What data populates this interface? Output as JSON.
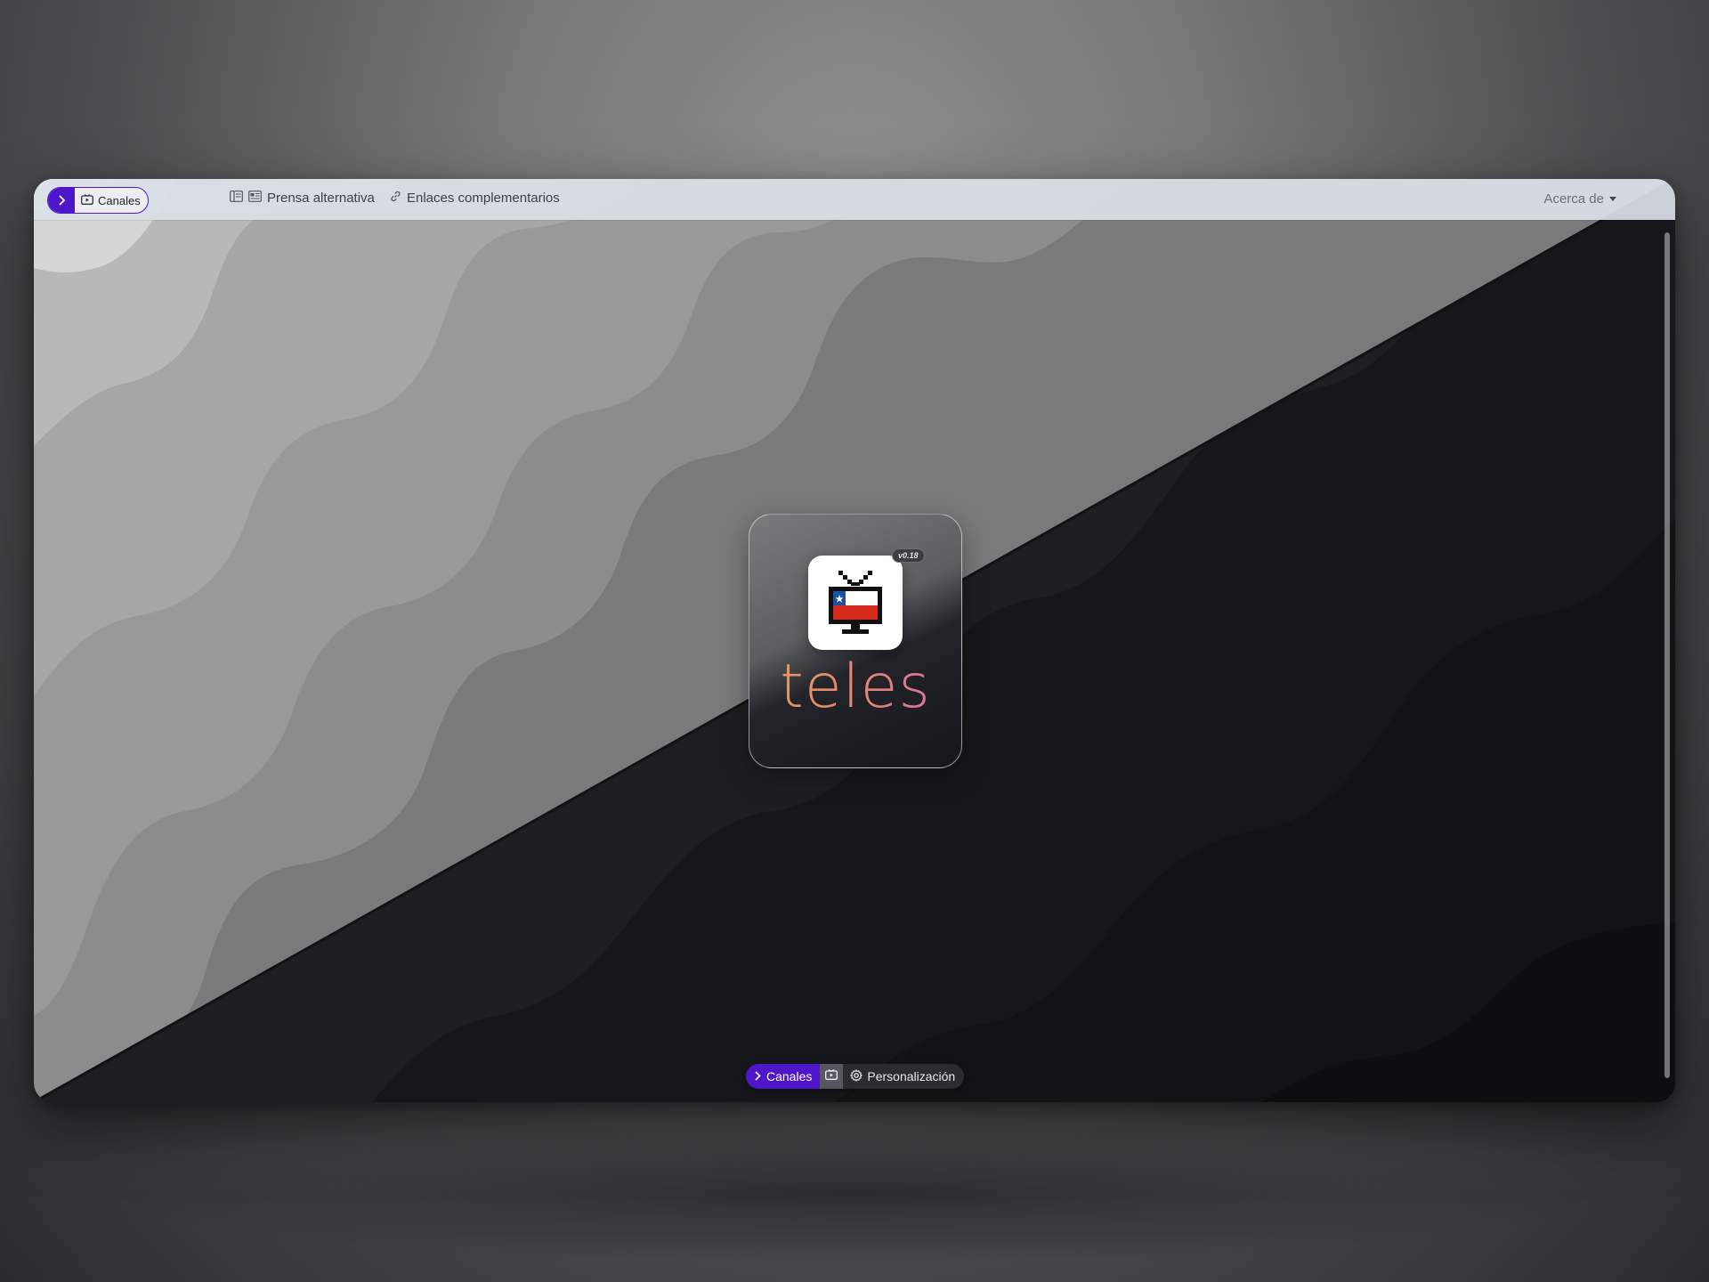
{
  "navbar": {
    "channels_label": "Canales",
    "links": [
      {
        "label": "Prensa alternativa",
        "icon": "newspaper-icon"
      },
      {
        "label": "Enlaces complementarios",
        "icon": "link-icon"
      }
    ],
    "about_label": "Acerca de"
  },
  "logo": {
    "version": "v0.18",
    "brand_name": "teles",
    "icon": "tv-chile-flag-icon"
  },
  "dock": {
    "channels_label": "Canales",
    "settings_label": "Personalización"
  },
  "colors": {
    "accent": "#4e17c9",
    "navbar_bg": "#dadfe7",
    "brand_gradient_start": "#e29a5c",
    "brand_gradient_end": "#d56ba8",
    "dark_bg": "#1b1d20"
  }
}
